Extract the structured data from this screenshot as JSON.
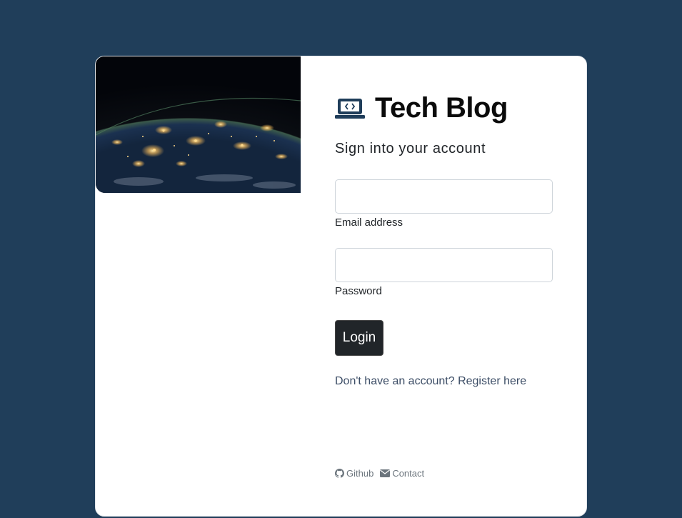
{
  "brand": {
    "title": "Tech Blog",
    "icon": "laptop-code-icon"
  },
  "login": {
    "subtitle": "Sign into your account",
    "email": {
      "label": "Email address",
      "value": "",
      "placeholder": ""
    },
    "password": {
      "label": "Password",
      "value": "",
      "placeholder": ""
    },
    "submit_label": "Login",
    "register_prompt": "Don't have an account? Register here"
  },
  "footer": {
    "links": [
      {
        "label": "Github",
        "icon": "github-icon"
      },
      {
        "label": "Contact",
        "icon": "envelope-icon"
      }
    ]
  },
  "colors": {
    "background": "#203e5a",
    "card": "#ffffff",
    "button": "#212529",
    "brand_icon": "#1f3d5a",
    "link": "#3c4d66",
    "muted": "#6c757d"
  }
}
